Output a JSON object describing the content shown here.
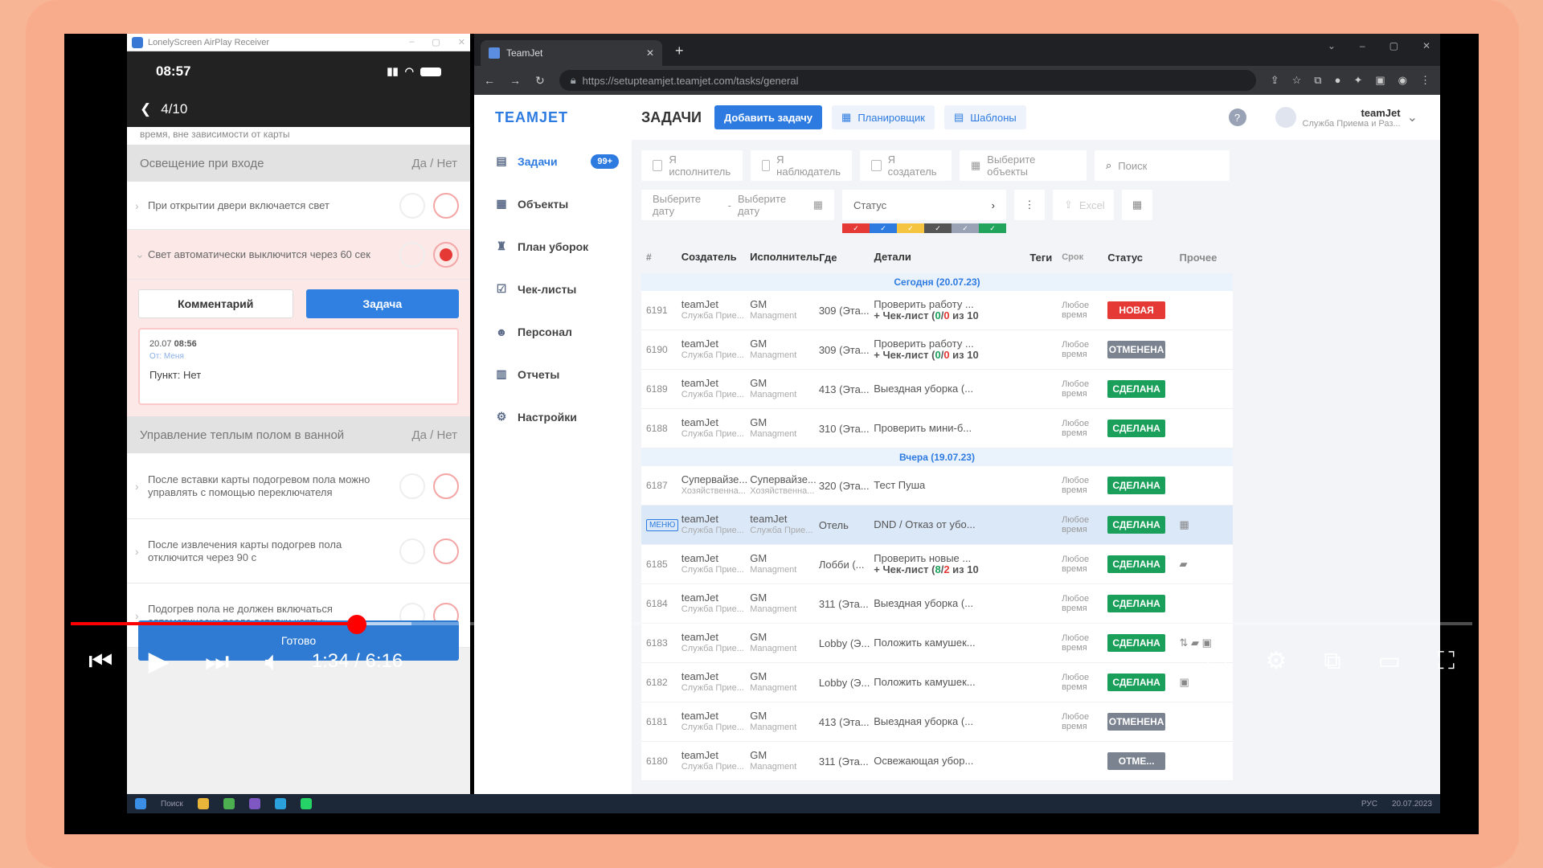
{
  "phone": {
    "window_title": "LonelyScreen AirPlay Receiver",
    "time": "08:57",
    "progress": "4/10",
    "truncated_text": "время, вне зависимости от карты",
    "section1": {
      "title": "Освещение при входе",
      "yes_no": "Да  / Нет"
    },
    "item1": "При открытии двери включается свет",
    "item2": "Свет автоматически выключится через 60 сек",
    "btn_comment": "Комментарий",
    "btn_task": "Задача",
    "comment": {
      "date": "20.07",
      "time": "08:56",
      "from": "От: Меня",
      "point": "Пункт: Нет"
    },
    "section2": {
      "title": "Управление теплым полом в ванной",
      "yes_no": "Да  / Нет"
    },
    "item3": "После вставки карты подогревом пола можно управлять с помощью переключателя",
    "item4": "После извлечения карты подогрев пола отключится через 90 с",
    "item5": "Подогрев пола не должен включаться автоматически после вставки карты",
    "done": "Готово"
  },
  "browser": {
    "tab_title": "TeamJet",
    "url": "https://setupteamjet.teamjet.com/tasks/general"
  },
  "app": {
    "logo": "TEAMJET",
    "nav": [
      {
        "label": "Задачи",
        "icon": "tasks-icon",
        "badge": "99+"
      },
      {
        "label": "Объекты",
        "icon": "objects-icon"
      },
      {
        "label": "План уборок",
        "icon": "cleaning-plan-icon"
      },
      {
        "label": "Чек-листы",
        "icon": "checklist-icon"
      },
      {
        "label": "Персонал",
        "icon": "staff-icon"
      },
      {
        "label": "Отчеты",
        "icon": "reports-icon"
      },
      {
        "label": "Настройки",
        "icon": "settings-icon"
      }
    ],
    "page_title": "ЗАДАЧИ",
    "add_task": "Добавить задачу",
    "planner": "Планировщик",
    "templates": "Шаблоны",
    "user": {
      "name": "teamJet",
      "role": "Служба Приема и Раз..."
    },
    "filters": {
      "executor": "Я исполнитель",
      "observer": "Я наблюдатель",
      "creator": "Я создатель",
      "objects": "Выберите объекты",
      "search_placeholder": "Поиск",
      "date_from": "Выберите дату",
      "date_to": "Выберите дату",
      "status": "Статус",
      "excel": "Excel"
    },
    "status_colors": [
      "#e53935",
      "#2d7be0",
      "#f5c542",
      "#555555",
      "#9aa3b5",
      "#22a45d"
    ],
    "columns": [
      "#",
      "Создатель",
      "Исполнитель",
      "Где",
      "Детали",
      "Теги",
      "Срок",
      "Статус",
      "Прочее"
    ],
    "group_today": "Сегодня (20.07.23)",
    "group_yesterday": "Вчера (19.07.23)",
    "rows": [
      {
        "id": "6191",
        "creator": "teamJet",
        "creator_sub": "Служба Прие...",
        "exec": "GM",
        "exec_sub": "Managment",
        "where": "309 (Эта...",
        "details": "Проверить работу ...",
        "details2_pre": "+ Чек-лист (",
        "c_green": "0",
        "c_red": "0",
        "details2_post": " из 10",
        "deadline1": "Любое",
        "deadline2": "время",
        "status": "НОВАЯ",
        "status_color": "#e53935",
        "other": ""
      },
      {
        "id": "6190",
        "creator": "teamJet",
        "creator_sub": "Служба Прие...",
        "exec": "GM",
        "exec_sub": "Managment",
        "where": "309 (Эта...",
        "details": "Проверить работу ...",
        "details2_pre": "+ Чек-лист (",
        "c_green": "0",
        "c_red": "0",
        "details2_post": " из 10",
        "deadline1": "Любое",
        "deadline2": "время",
        "status": "ОТМЕНЕНА",
        "status_color": "#7b8290",
        "other": ""
      },
      {
        "id": "6189",
        "creator": "teamJet",
        "creator_sub": "Служба Прие...",
        "exec": "GM",
        "exec_sub": "Managment",
        "where": "413 (Эта...",
        "details": "Выездная уборка (...",
        "deadline1": "Любое",
        "deadline2": "время",
        "status": "СДЕЛАНА",
        "status_color": "#1aa05a",
        "other": ""
      },
      {
        "id": "6188",
        "creator": "teamJet",
        "creator_sub": "Служба Прие...",
        "exec": "GM",
        "exec_sub": "Managment",
        "where": "310 (Эта...",
        "details": "Проверить мини-б...",
        "deadline1": "Любое",
        "deadline2": "время",
        "status": "СДЕЛАНА",
        "status_color": "#1aa05a",
        "other": ""
      },
      {
        "id": "6187",
        "creator": "Супервайзе...",
        "creator_sub": "Хозяйственна...",
        "exec": "Супервайзе...",
        "exec_sub": "Хозяйственна...",
        "where": "320 (Эта...",
        "details": "Тест Пуша",
        "deadline1": "Любое",
        "deadline2": "время",
        "status": "СДЕЛАНА",
        "status_color": "#1aa05a",
        "other": ""
      },
      {
        "id": "МЕНЮ",
        "creator": "teamJet",
        "creator_sub": "Служба Прие...",
        "exec": "teamJet",
        "exec_sub": "Служба Прие...",
        "where": "Отель",
        "details": "DND / Отказ от убо...",
        "deadline1": "Любое",
        "deadline2": "время",
        "status": "СДЕЛАНА",
        "status_color": "#1aa05a",
        "other": "▦"
      },
      {
        "id": "6185",
        "creator": "teamJet",
        "creator_sub": "Служба Прие...",
        "exec": "GM",
        "exec_sub": "Managment",
        "where": "Лобби (...",
        "details": "Проверить новые ...",
        "details2_pre": "+ Чек-лист (",
        "c_green": "8",
        "c_red": "2",
        "details2_post": " из 10",
        "deadline1": "Любое",
        "deadline2": "время",
        "status": "СДЕЛАНА",
        "status_color": "#1aa05a",
        "other": "▰"
      },
      {
        "id": "6184",
        "creator": "teamJet",
        "creator_sub": "Служба Прие...",
        "exec": "GM",
        "exec_sub": "Managment",
        "where": "311 (Эта...",
        "details": "Выездная уборка (...",
        "deadline1": "Любое",
        "deadline2": "время",
        "status": "СДЕЛАНА",
        "status_color": "#1aa05a",
        "other": ""
      },
      {
        "id": "6183",
        "creator": "teamJet",
        "creator_sub": "Служба Прие...",
        "exec": "GM",
        "exec_sub": "Managment",
        "where": "Lobby (Э...",
        "details": "Положить камушек...",
        "deadline1": "Любое",
        "deadline2": "время",
        "status": "СДЕЛАНА",
        "status_color": "#1aa05a",
        "other": "⇅ ▰ ▣"
      },
      {
        "id": "6182",
        "creator": "teamJet",
        "creator_sub": "Служба Прие...",
        "exec": "GM",
        "exec_sub": "Managment",
        "where": "Lobby (Э...",
        "details": "Положить камушек...",
        "deadline1": "Любое",
        "deadline2": "время",
        "status": "СДЕЛАНА",
        "status_color": "#1aa05a",
        "other": "▣"
      },
      {
        "id": "6181",
        "creator": "teamJet",
        "creator_sub": "Служба Прие...",
        "exec": "GM",
        "exec_sub": "Managment",
        "where": "413 (Эта...",
        "details": "Выездная уборка (...",
        "deadline1": "Любое",
        "deadline2": "время",
        "status": "ОТМЕНЕНА",
        "status_color": "#7b8290",
        "other": ""
      },
      {
        "id": "6180",
        "creator": "teamJet",
        "creator_sub": "Служба Прие...",
        "exec": "GM",
        "exec_sub": "Managment",
        "where": "311 (Эта...",
        "details": "Освежающая убор...",
        "deadline1": "",
        "deadline2": "",
        "status": "ОТМЕ...",
        "status_color": "#7b8290",
        "other": ""
      }
    ]
  },
  "player": {
    "time": "1:34 / 6:16",
    "progress_fraction": 0.25,
    "buffered_fraction": 0.29,
    "colors": {
      "progress": "#ff0000",
      "frame": "#f9ac8b"
    }
  },
  "taskbar": {
    "search": "Поиск",
    "lang": "РУС",
    "date": "20.07.2023"
  }
}
